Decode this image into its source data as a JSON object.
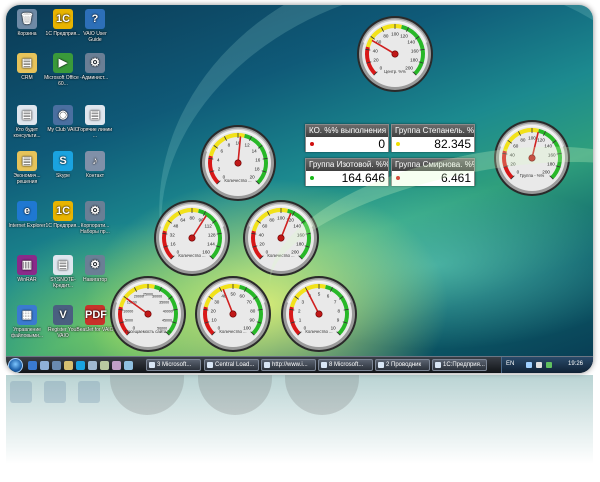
{
  "desktop": {
    "icons": [
      {
        "label": "Корзина",
        "glyph": "🗑",
        "color": "#6f8aa6"
      },
      {
        "label": "1С Предприя...",
        "glyph": "1С",
        "color": "#e8b400"
      },
      {
        "label": "VAIO User Guide",
        "glyph": "?",
        "color": "#2d6fb8"
      },
      {
        "label": "CRM",
        "glyph": "▤",
        "color": "#e6c35a"
      },
      {
        "label": "Microsoft Office - 60...",
        "glyph": "▶",
        "color": "#3a9a3a"
      },
      {
        "label": "Админист...",
        "glyph": "⚙",
        "color": "#6a7f95"
      },
      {
        "label": "Кто будет консульти...",
        "glyph": "▤",
        "color": "#dfe6ee"
      },
      {
        "label": "My Club VAIO",
        "glyph": "◉",
        "color": "#4a6fa0"
      },
      {
        "label": "Горячие линии ...",
        "glyph": "▤",
        "color": "#dfe6ee"
      },
      {
        "label": "Экономич... решения",
        "glyph": "▤",
        "color": "#e6c35a"
      },
      {
        "label": "Skype",
        "glyph": "S",
        "color": "#1aa3e0"
      },
      {
        "label": "Контакт",
        "glyph": "♪",
        "color": "#8090a8"
      },
      {
        "label": "Internet Explorer",
        "glyph": "e",
        "color": "#1f78d1"
      },
      {
        "label": "1С Предприя...",
        "glyph": "1С",
        "color": "#e8b400"
      },
      {
        "label": "Корпорати... Наборы пр...",
        "glyph": "⚙",
        "color": "#6a7f95"
      },
      {
        "label": "WinRAR",
        "glyph": "▥",
        "color": "#8a2a8a"
      },
      {
        "label": "SYSNOTE- Кредит...",
        "glyph": "▤",
        "color": "#dfe6ee"
      },
      {
        "label": "Навигатор",
        "glyph": "⚙",
        "color": "#6a7f95"
      },
      {
        "label": "Управление файловыми...",
        "glyph": "▦",
        "color": "#3a7ad0"
      },
      {
        "label": "Register Your VAIO",
        "glyph": "V",
        "color": "#4a5f80"
      },
      {
        "label": "BeatJet for VAIO",
        "glyph": "PDF",
        "color": "#c8312a"
      }
    ]
  },
  "gauges": [
    {
      "id": "center",
      "label": "Центр. %%",
      "ticks": [
        "0",
        "20",
        "40",
        "60",
        "80",
        "100",
        "120",
        "140",
        "160",
        "180",
        "200"
      ],
      "needle": 0.28
    },
    {
      "id": "g-mid-left",
      "label": "Количество ...",
      "ticks": [
        "0",
        "2",
        "4",
        "6",
        "8",
        "10",
        "12",
        "14",
        "16",
        "18",
        "20"
      ],
      "needle": 0.52
    },
    {
      "id": "g-right",
      "label": "Группа - %%",
      "ticks": [
        "0",
        "20",
        "40",
        "60",
        "80",
        "100",
        "120",
        "140",
        "160",
        "180",
        "200"
      ],
      "needle": 0.55
    },
    {
      "id": "g-row3-a",
      "label": "Количество ...",
      "ticks": [
        "0",
        "16",
        "32",
        "48",
        "64",
        "80",
        "96",
        "112",
        "128",
        "144",
        "160"
      ],
      "needle": 0.62
    },
    {
      "id": "g-row3-b",
      "label": "Количество ...",
      "ticks": [
        "0",
        "20",
        "40",
        "60",
        "80",
        "100",
        "120",
        "140",
        "160",
        "180",
        "200"
      ],
      "needle": 0.58
    },
    {
      "id": "g-row4-a",
      "label": "Посещаемость сайта %",
      "ticks": [
        "0",
        "5000",
        "10000",
        "15000",
        "20000",
        "25000",
        "30000",
        "35000",
        "40000",
        "45000",
        "50000"
      ],
      "needle": 0.3
    },
    {
      "id": "g-row4-b",
      "label": "Количество ...",
      "ticks": [
        "0",
        "10",
        "20",
        "30",
        "40",
        "50",
        "60",
        "70",
        "80",
        "90",
        "100"
      ],
      "needle": 0.42
    },
    {
      "id": "g-row4-c",
      "label": "Количество ...",
      "ticks": [
        "0",
        "1",
        "2",
        "3",
        "4",
        "5",
        "6",
        "7",
        "8",
        "9",
        "10"
      ],
      "needle": 0.4
    }
  ],
  "panels": [
    {
      "title": "КО. %% выполнения м",
      "value": "0",
      "dot_color": "#d01010"
    },
    {
      "title": "Группа Степанель. %%",
      "value": "82.345",
      "dot_color": "#f0e000"
    },
    {
      "title": "Группа Изотовой. %%",
      "value": "164.646",
      "dot_color": "#18b818"
    },
    {
      "title": "Группа Смирнова. %%",
      "value": "6.461",
      "dot_color": "#d01010"
    }
  ],
  "taskbar": {
    "tasks": [
      "3 Microsoft...",
      "Central Load...",
      "http://www.i...",
      "8 Microsoft...",
      "2 Проводник",
      "1С:Предприя..."
    ],
    "lang": "EN",
    "time": "19:26"
  },
  "colors": {
    "gauge_red": "#d81818",
    "gauge_yellow": "#f2e21a",
    "gauge_green": "#28b828"
  }
}
